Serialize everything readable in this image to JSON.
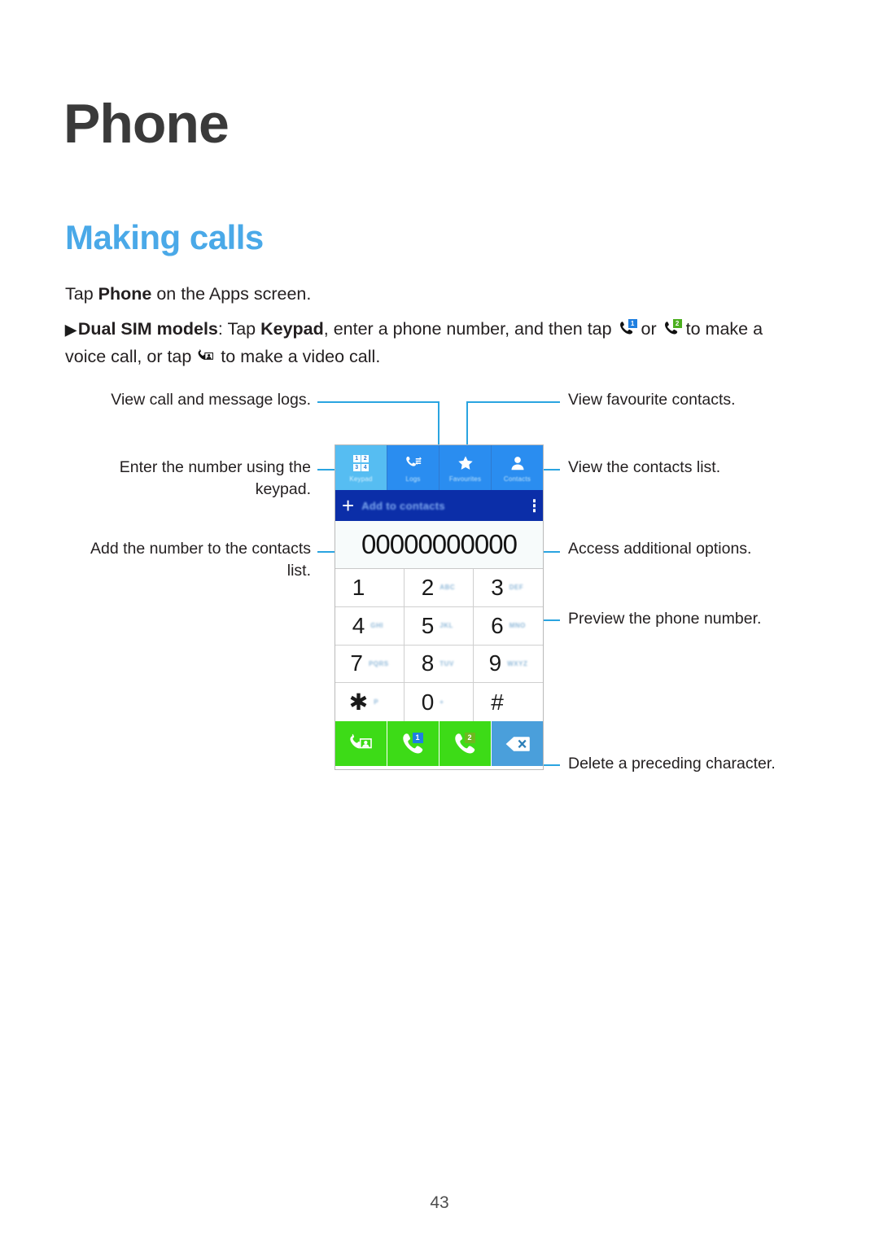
{
  "page": {
    "title": "Phone",
    "section_title": "Making calls",
    "number": "43"
  },
  "body": {
    "line1_pre": "Tap ",
    "line1_bold": "Phone",
    "line1_post": " on the Apps screen.",
    "line2_arrow": "▶",
    "line2_bold1": "Dual SIM models",
    "line2_t1": ": Tap ",
    "line2_bold2": "Keypad",
    "line2_t2": ", enter a phone number, and then tap ",
    "line2_t3": " or ",
    "line2_t4": " to make a voice call, or tap ",
    "line2_t5": " to make a video call.",
    "icon_call_sim1": "phone-handset-sim1-icon",
    "icon_call_sim2": "phone-handset-sim2-icon",
    "icon_video_call": "video-call-icon",
    "sim1_badge": "1",
    "sim2_badge": "2"
  },
  "callouts": {
    "logs": "View call and message logs.",
    "keypad": "Enter the number using the\nkeypad.",
    "add_contacts": "Add the number to the contacts\nlist.",
    "favourites": "View favourite contacts.",
    "contacts": "View the contacts list.",
    "more_options": "Access additional options.",
    "preview": "Preview the phone number.",
    "delete": "Delete a preceding character."
  },
  "phone_ui": {
    "tabs": [
      {
        "label": "Keypad",
        "icon": "keypad-grid-icon",
        "active": true
      },
      {
        "label": "Logs",
        "icon": "call-logs-icon",
        "active": false
      },
      {
        "label": "Favourites",
        "icon": "star-icon",
        "active": false
      },
      {
        "label": "Contacts",
        "icon": "person-icon",
        "active": false
      }
    ],
    "keypad_digits": [
      "1",
      "2",
      "3",
      "4"
    ],
    "add_bar": {
      "plus": "+",
      "label": "Add to contacts",
      "overflow_icon": "kebab-menu-icon"
    },
    "number_display": "00000000000",
    "keys": [
      {
        "digit": "1",
        "letters": ""
      },
      {
        "digit": "2",
        "letters": "ABC"
      },
      {
        "digit": "3",
        "letters": "DEF"
      },
      {
        "digit": "4",
        "letters": "GHI"
      },
      {
        "digit": "5",
        "letters": "JKL"
      },
      {
        "digit": "6",
        "letters": "MNO"
      },
      {
        "digit": "7",
        "letters": "PQRS"
      },
      {
        "digit": "8",
        "letters": "TUV"
      },
      {
        "digit": "9",
        "letters": "WXYZ"
      },
      {
        "digit": "✱",
        "letters": "P"
      },
      {
        "digit": "0",
        "letters": "+"
      },
      {
        "digit": "#",
        "letters": ""
      }
    ],
    "actions": [
      {
        "name": "video-call-button",
        "icon": "video-call-icon",
        "badge": "",
        "color": "#3ddb17"
      },
      {
        "name": "call-sim1-button",
        "icon": "phone-handset-icon",
        "badge": "1",
        "color": "#3ddb17"
      },
      {
        "name": "call-sim2-button",
        "icon": "phone-handset-icon",
        "badge": "2",
        "color": "#3ddb17"
      },
      {
        "name": "backspace-button",
        "icon": "backspace-icon",
        "badge": "",
        "color": "#4a9fdb"
      }
    ]
  },
  "colors": {
    "accent": "#4aa9e8",
    "leader": "#2aa4e0",
    "tab_active": "#56bdf2",
    "tab_inactive": "#2a8df0",
    "add_bar": "#0b2ea8",
    "call_green": "#3ddb17",
    "delete_blue": "#4a9fdb"
  }
}
